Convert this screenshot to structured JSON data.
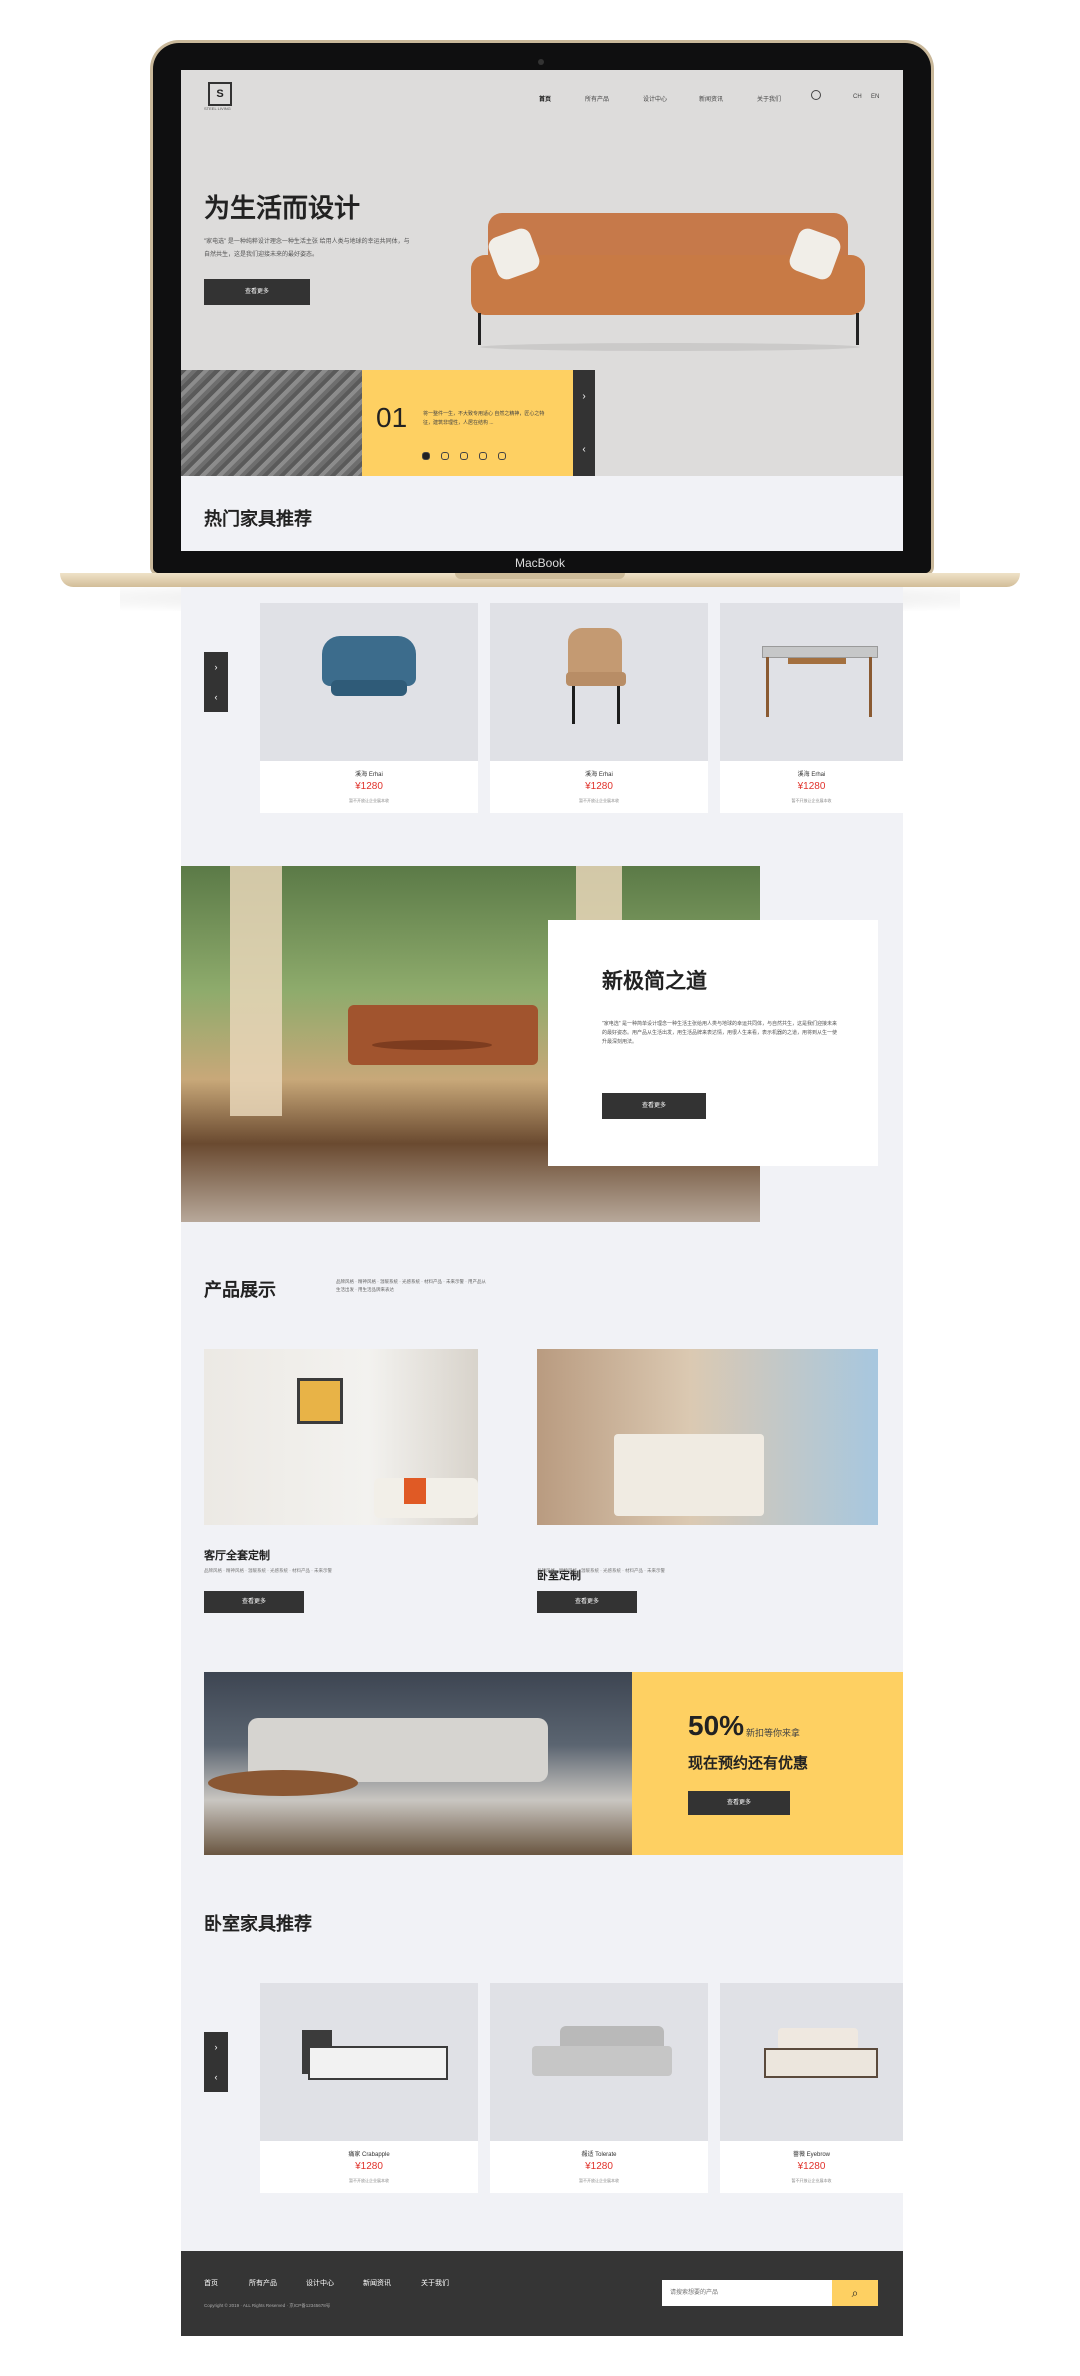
{
  "device": {
    "brand": "MacBook"
  },
  "nav": {
    "logo_text": "S",
    "logo_sub": "STEEL LIVING",
    "items": [
      "首页",
      "所有产品",
      "设计中心",
      "新闻资讯",
      "关于我们"
    ],
    "lang": [
      "CH",
      "EN"
    ]
  },
  "hero": {
    "title": "为生活而设计",
    "text": "\"家电选\" 是一种纯粹设计理念一种生活主张 给用人类与地球的幸运共同体，与自然共生，这是我们迎接未来的最好姿态。",
    "button": "查看更多",
    "slide_number": "01",
    "slide_text": "将一整件一生，不大致专用适心 自然之精神，匠心之特征，建筑非理性，人居在结构 ...",
    "dots": 5
  },
  "hot": {
    "title": "热门家具推荐",
    "products": [
      {
        "name": "溪海 Erhai",
        "price": "¥1280",
        "note": "暂不开放让企业展本收"
      },
      {
        "name": "溪海 Erhai",
        "price": "¥1280",
        "note": "暂不开放让企业展本收"
      },
      {
        "name": "溪海 Erhai",
        "price": "¥1280",
        "note": "暂不开放让企业展本收"
      }
    ]
  },
  "feature": {
    "title": "新极简之道",
    "text": "\"家电选\" 是一种简单设计理念一种生活主张给用人类与地球的幸运共同体，与自然共生，这是我们迎接未来的最好姿态。用产品从生活出发，用生活品牌来表达情，用很人生来看，表示机器的之道，用将到从生一使升最深刻用法。",
    "button": "查看更多"
  },
  "products": {
    "title": "产品展示",
    "desc": "品牌风格 · 精神风格 · 温暖系统 · 光感系统 · 材料产品 · 未来示警 · 用产品从生活出发 · 用生活品牌来表达",
    "items": [
      {
        "title": "客厅全套定制",
        "text": "品牌风格 · 精神风格 · 温暖系统 · 光感系统 · 材料产品 · 未来示警",
        "button": "查看更多"
      },
      {
        "title": "卧室定制",
        "text": "品牌风格 · 精神风格 · 温暖系统 · 光感系统 · 材料产品 · 未来示警",
        "button": "查看更多"
      }
    ]
  },
  "promo": {
    "percent": "50%",
    "percent_note": "新扣等你来拿",
    "title": "现在预约还有优惠",
    "button": "查看更多"
  },
  "bedroom": {
    "title": "卧室家具推荐",
    "products": [
      {
        "name": "痛家 Crabapple",
        "price": "¥1280",
        "note": "暂不开放让企业展本收"
      },
      {
        "name": "赧适 Tolerate",
        "price": "¥1280",
        "note": "暂不开放让企业展本收"
      },
      {
        "name": "蔷薇 Eyebrow",
        "price": "¥1280",
        "note": "暂不开放让企业展本收"
      }
    ]
  },
  "footer": {
    "links": [
      "首页",
      "所有产品",
      "设计中心",
      "新闻资讯",
      "关于我们"
    ],
    "copyright": "Copyright © 2019 · ALL Rights Reserved · 京ICP备12345678号",
    "search_placeholder": "请搜索想要的产品"
  },
  "colors": {
    "accent": "#fed062",
    "dark": "#333333",
    "price": "#e0322b"
  }
}
